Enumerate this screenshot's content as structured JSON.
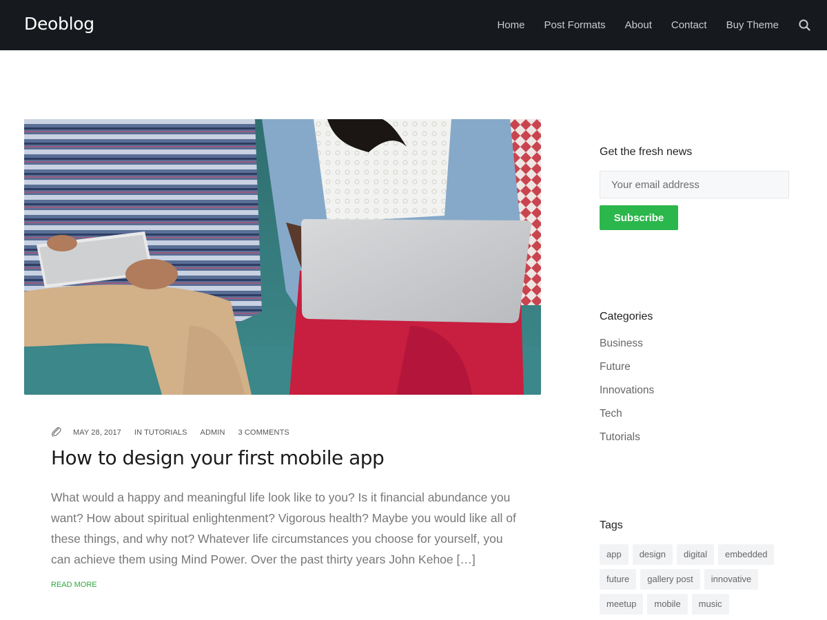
{
  "site": {
    "title": "Deoblog"
  },
  "nav": {
    "items": [
      "Home",
      "Post Formats",
      "About",
      "Contact",
      "Buy Theme"
    ]
  },
  "post": {
    "date": "MAY 28, 2017",
    "category_prefix": "IN",
    "category": "TUTORIALS",
    "author": "ADMIN",
    "comments": "3 COMMENTS",
    "title": "How to design your first mobile app",
    "excerpt": "What would a happy and meaningful life look like to you? Is it financial abundance you want? How about spiritual enlightenment? Vigorous health? Maybe you would like all of these things, and why not? Whatever life circumstances you choose for yourself, you can achieve them using Mind Power. Over the past thirty years John Kehoe […]",
    "read_more": "READ MORE"
  },
  "sidebar": {
    "newsletter": {
      "title": "Get the fresh news",
      "email_placeholder": "Your email address",
      "button": "Subscribe"
    },
    "categories": {
      "title": "Categories",
      "items": [
        "Business",
        "Future",
        "Innovations",
        "Tech",
        "Tutorials"
      ]
    },
    "tags": {
      "title": "Tags",
      "items": [
        "app",
        "design",
        "digital",
        "embedded",
        "future",
        "gallery post",
        "innovative",
        "meetup",
        "mobile",
        "music"
      ]
    }
  },
  "colors": {
    "header_bg": "#16191e",
    "accent_green": "#2bb74b"
  }
}
